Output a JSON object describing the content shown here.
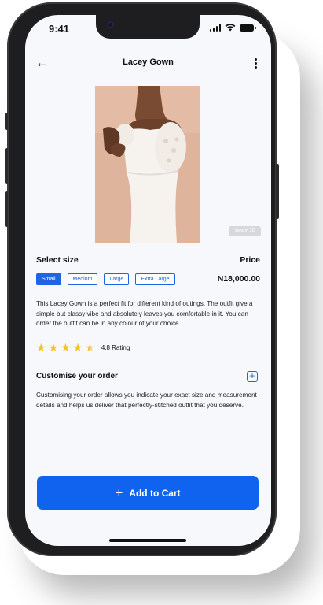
{
  "status_bar": {
    "time": "9:41"
  },
  "header": {
    "title": "Lacey Gown",
    "back_icon": "arrow-left-icon",
    "menu_icon": "kebab-icon"
  },
  "product_image": {
    "alt": "Lacey Gown",
    "view_3d_label": "View in 3D"
  },
  "size_section": {
    "label": "Select size",
    "options": [
      "Small",
      "Medium",
      "Large",
      "Extra Large"
    ],
    "selected": "Small"
  },
  "price_section": {
    "label": "Price",
    "value": "N18,000.00"
  },
  "description": "This Lacey Gown is a perfect fit for different kind of outings. The outfit give a simple but classy vibe and absolutely leaves you comfortable in it. You can order the outfit can be in any colour of your choice.",
  "rating": {
    "stars": 4.5,
    "max": 5,
    "label": "4.8 Rating"
  },
  "customise": {
    "title": "Customise your order",
    "description": "Customising your order allows you indicate your exact size and measurement details and helps us deliver that perfectly-stitched outfit that you deserve."
  },
  "cart_button": {
    "label": "Add to Cart"
  },
  "colors": {
    "accent": "#0f63ee",
    "star": "#f6c21a",
    "background": "#f7f8fb"
  }
}
